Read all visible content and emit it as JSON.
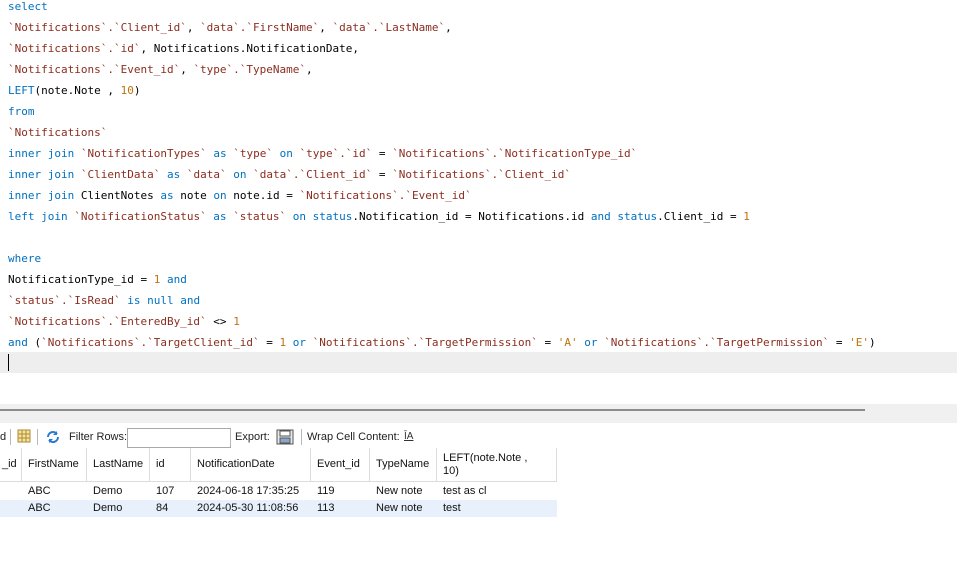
{
  "editor": {
    "lines": [
      [
        {
          "t": "select",
          "c": "kw"
        }
      ],
      [
        {
          "t": "`Notifications`.`Client_id`",
          "c": "id"
        },
        {
          "t": ", ",
          "c": ""
        },
        {
          "t": "`data`.`FirstName`",
          "c": "id"
        },
        {
          "t": ", ",
          "c": ""
        },
        {
          "t": "`data`.`LastName`",
          "c": "id"
        },
        {
          "t": ",",
          "c": ""
        }
      ],
      [
        {
          "t": "`Notifications`.`id`",
          "c": "id"
        },
        {
          "t": ", Notifications.NotificationDate,",
          "c": ""
        }
      ],
      [
        {
          "t": "`Notifications`.`Event_id`",
          "c": "id"
        },
        {
          "t": ", ",
          "c": ""
        },
        {
          "t": "`type`.`TypeName`",
          "c": "id"
        },
        {
          "t": ",",
          "c": ""
        }
      ],
      [
        {
          "t": "LEFT",
          "c": "kw"
        },
        {
          "t": "(note.Note , ",
          "c": ""
        },
        {
          "t": "10",
          "c": "num"
        },
        {
          "t": ")",
          "c": ""
        }
      ],
      [
        {
          "t": "from",
          "c": "kw"
        }
      ],
      [
        {
          "t": "`Notifications`",
          "c": "id"
        }
      ],
      [
        {
          "t": "inner join ",
          "c": "kw"
        },
        {
          "t": "`NotificationTypes`",
          "c": "id"
        },
        {
          "t": " as ",
          "c": "kw"
        },
        {
          "t": "`type`",
          "c": "id"
        },
        {
          "t": " on ",
          "c": "kw"
        },
        {
          "t": "`type`.`id`",
          "c": "id"
        },
        {
          "t": " = ",
          "c": ""
        },
        {
          "t": "`Notifications`.`NotificationType_id`",
          "c": "id"
        }
      ],
      [
        {
          "t": "inner join ",
          "c": "kw"
        },
        {
          "t": "`ClientData`",
          "c": "id"
        },
        {
          "t": " as ",
          "c": "kw"
        },
        {
          "t": "`data`",
          "c": "id"
        },
        {
          "t": " on ",
          "c": "kw"
        },
        {
          "t": "`data`.`Client_id`",
          "c": "id"
        },
        {
          "t": " = ",
          "c": ""
        },
        {
          "t": "`Notifications`.`Client_id`",
          "c": "id"
        }
      ],
      [
        {
          "t": "inner join ",
          "c": "kw"
        },
        {
          "t": "ClientNotes ",
          "c": ""
        },
        {
          "t": "as ",
          "c": "kw"
        },
        {
          "t": "note ",
          "c": ""
        },
        {
          "t": "on ",
          "c": "kw"
        },
        {
          "t": "note.id = ",
          "c": ""
        },
        {
          "t": "`Notifications`.`Event_id`",
          "c": "id"
        }
      ],
      [
        {
          "t": "left join ",
          "c": "kw"
        },
        {
          "t": "`NotificationStatus`",
          "c": "id"
        },
        {
          "t": " as ",
          "c": "kw"
        },
        {
          "t": "`status`",
          "c": "id"
        },
        {
          "t": " on ",
          "c": "kw"
        },
        {
          "t": "status",
          "c": "kw"
        },
        {
          "t": ".Notification_id = Notifications.id ",
          "c": ""
        },
        {
          "t": "and ",
          "c": "kw"
        },
        {
          "t": "status",
          "c": "kw"
        },
        {
          "t": ".Client_id = ",
          "c": ""
        },
        {
          "t": "1",
          "c": "num"
        }
      ],
      [],
      [
        {
          "t": "where",
          "c": "kw"
        }
      ],
      [
        {
          "t": "NotificationType_id = ",
          "c": ""
        },
        {
          "t": "1",
          "c": "num"
        },
        {
          "t": " and",
          "c": "kw"
        }
      ],
      [
        {
          "t": "`status`.`IsRead`",
          "c": "id"
        },
        {
          "t": " is null and",
          "c": "kw"
        }
      ],
      [
        {
          "t": "`Notifications`.`EnteredBy_id`",
          "c": "id"
        },
        {
          "t": " <> ",
          "c": ""
        },
        {
          "t": "1",
          "c": "num"
        }
      ],
      [
        {
          "t": "and ",
          "c": "kw"
        },
        {
          "t": "(",
          "c": ""
        },
        {
          "t": "`Notifications`.`TargetClient_id`",
          "c": "id"
        },
        {
          "t": " = ",
          "c": ""
        },
        {
          "t": "1",
          "c": "num"
        },
        {
          "t": " or ",
          "c": "kw"
        },
        {
          "t": "`Notifications`.`TargetPermission`",
          "c": "id"
        },
        {
          "t": " = ",
          "c": ""
        },
        {
          "t": "'A'",
          "c": "str"
        },
        {
          "t": " or ",
          "c": "kw"
        },
        {
          "t": "`Notifications`.`TargetPermission`",
          "c": "id"
        },
        {
          "t": " = ",
          "c": ""
        },
        {
          "t": "'E'",
          "c": "str"
        },
        {
          "t": ")",
          "c": ""
        }
      ]
    ]
  },
  "toolbar": {
    "partial_label": "d",
    "filter_rows_label": "Filter Rows:",
    "filter_rows_value": "",
    "export_label": "Export:",
    "wrap_label": "Wrap Cell Content:",
    "wrap_icon_text": "ĪA"
  },
  "grid": {
    "columns": [
      "_id",
      "FirstName",
      "LastName",
      "id",
      "NotificationDate",
      "Event_id",
      "TypeName",
      "LEFT(note.Note ,\n10)"
    ],
    "rows": [
      [
        "",
        "ABC",
        "Demo",
        "107",
        "2024-06-18 17:35:25",
        "119",
        "New note",
        "test as cl"
      ],
      [
        "",
        "ABC",
        "Demo",
        "84",
        "2024-05-30 11:08:56",
        "113",
        "New note",
        "test"
      ]
    ]
  },
  "colors": {
    "keyword": "#0070c0",
    "identifier": "#8b2d1f",
    "number": "#c0700c",
    "selected_row": "#e8f0fb"
  }
}
